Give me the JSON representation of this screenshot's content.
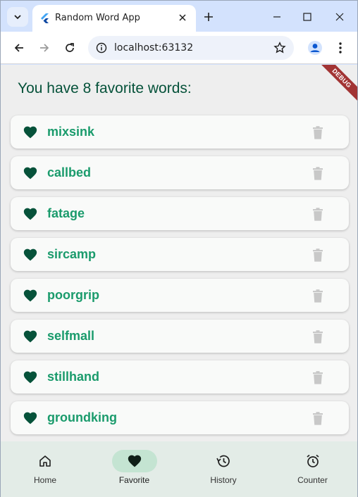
{
  "browser": {
    "tab_title": "Random Word App",
    "url": "localhost:63132"
  },
  "app": {
    "debug_banner": "DEBUG",
    "heading": "You have 8 favorite words:",
    "favorites": [
      {
        "word": "mixsink"
      },
      {
        "word": "callbed"
      },
      {
        "word": "fatage"
      },
      {
        "word": "sircamp"
      },
      {
        "word": "poorgrip"
      },
      {
        "word": "selfmall"
      },
      {
        "word": "stillhand"
      },
      {
        "word": "groundking"
      }
    ],
    "nav": [
      {
        "label": "Home",
        "icon": "home-icon"
      },
      {
        "label": "Favorite",
        "icon": "heart-icon",
        "selected": true
      },
      {
        "label": "History",
        "icon": "history-icon"
      },
      {
        "label": "Counter",
        "icon": "alarm-icon"
      }
    ]
  },
  "colors": {
    "accent": "#06523a",
    "word": "#1a9b6c",
    "nav_active": "#c4e4d2"
  }
}
